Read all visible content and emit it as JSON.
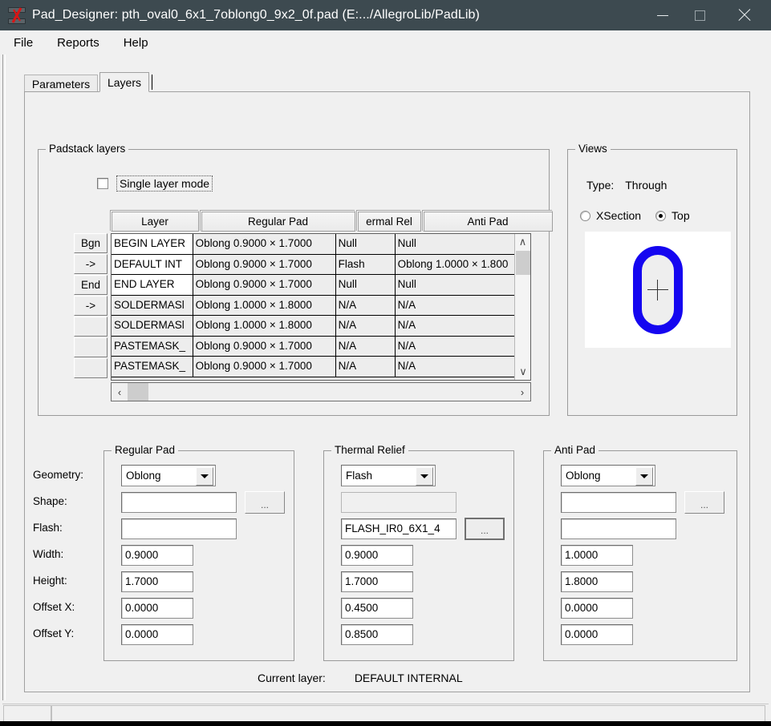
{
  "window": {
    "title": "Pad_Designer: pth_oval0_6x1_7oblong0_9x2_0f.pad (E:.../AllegroLib/PadLib)",
    "icon": "pad-designer-icon",
    "minimize": "—",
    "maximize": "□",
    "close": "✕"
  },
  "menubar": {
    "items": [
      {
        "label": "File"
      },
      {
        "label": "Reports"
      },
      {
        "label": "Help"
      }
    ]
  },
  "tabs": [
    {
      "label": "Parameters",
      "active": false
    },
    {
      "label": "Layers",
      "active": true
    }
  ],
  "padstack": {
    "group_label": "Padstack layers",
    "single_layer_mode": {
      "label": "Single layer mode",
      "checked": false
    },
    "columns": [
      "Layer",
      "Regular Pad",
      "ermal Rel",
      "Anti Pad"
    ],
    "side_buttons": [
      "Bgn",
      "->",
      "End",
      "->",
      "",
      "",
      ""
    ],
    "rows": [
      {
        "layer": "BEGIN LAYER",
        "regular_pad": "Oblong 0.9000 × 1.7000",
        "thermal_relief": "Null",
        "anti_pad": "Null",
        "editable": true
      },
      {
        "layer": "DEFAULT INT",
        "regular_pad": "Oblong 0.9000 × 1.7000",
        "thermal_relief": "Flash",
        "anti_pad": "Oblong 1.0000 × 1.800",
        "editable": true
      },
      {
        "layer": "END LAYER",
        "regular_pad": "Oblong 0.9000 × 1.7000",
        "thermal_relief": "Null",
        "anti_pad": "Null",
        "editable": true
      },
      {
        "layer": "SOLDERMASl",
        "regular_pad": "Oblong 1.0000 × 1.8000",
        "thermal_relief": "N/A",
        "anti_pad": "N/A",
        "editable": false
      },
      {
        "layer": "SOLDERMASl",
        "regular_pad": "Oblong 1.0000 × 1.8000",
        "thermal_relief": "N/A",
        "anti_pad": "N/A",
        "editable": false
      },
      {
        "layer": "PASTEMASK_",
        "regular_pad": "Oblong 0.9000 × 1.7000",
        "thermal_relief": "N/A",
        "anti_pad": "N/A",
        "editable": false
      },
      {
        "layer": "PASTEMASK_",
        "regular_pad": "Oblong 0.9000 × 1.7000",
        "thermal_relief": "N/A",
        "anti_pad": "N/A",
        "editable": false
      }
    ],
    "scroll_up": "∧",
    "scroll_down": "∨",
    "scroll_left": "‹",
    "scroll_right": "›"
  },
  "views": {
    "group_label": "Views",
    "type_label": "Type:",
    "type_value": "Through",
    "options": [
      {
        "label": "XSection",
        "selected": false
      },
      {
        "label": "Top",
        "selected": true
      }
    ],
    "preview_shape_color": "#1506f0",
    "preview_bg": "#ffffff"
  },
  "field_labels": {
    "geometry": "Geometry:",
    "shape": "Shape:",
    "flash": "Flash:",
    "width": "Width:",
    "height": "Height:",
    "offset_x": "Offset X:",
    "offset_y": "Offset Y:"
  },
  "regular_pad": {
    "group_label": "Regular Pad",
    "geometry": "Oblong",
    "shape": "",
    "flash": "",
    "width": "0.9000",
    "height": "1.7000",
    "offset_x": "0.0000",
    "offset_y": "0.0000",
    "browse_label": "..."
  },
  "thermal_relief": {
    "group_label": "Thermal Relief",
    "geometry": "Flash",
    "shape": "",
    "flash": "FLASH_IR0_6X1_4",
    "width": "0.9000",
    "height": "1.7000",
    "offset_x": "0.4500",
    "offset_y": "0.8500",
    "browse_label": "..."
  },
  "anti_pad": {
    "group_label": "Anti Pad",
    "geometry": "Oblong",
    "shape": "",
    "flash": "",
    "width": "1.0000",
    "height": "1.8000",
    "offset_x": "0.0000",
    "offset_y": "0.0000",
    "browse_label": "..."
  },
  "footer": {
    "current_layer_label": "Current layer:",
    "current_layer_value": "DEFAULT INTERNAL"
  }
}
